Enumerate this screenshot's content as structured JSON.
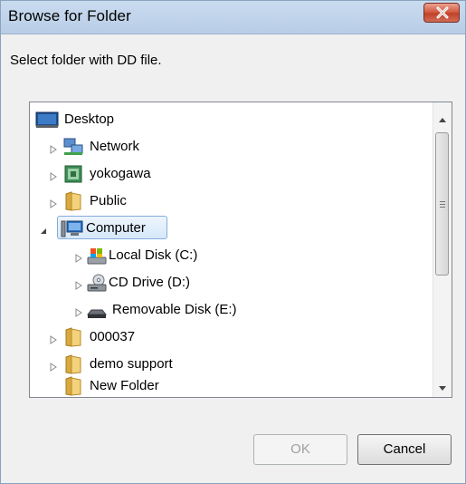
{
  "window": {
    "title": "Browse for Folder",
    "prompt": "Select folder with DD file."
  },
  "tree": {
    "items": [
      {
        "label": "Desktop",
        "icon": "desktop-icon",
        "expander": "none",
        "selected": false
      },
      {
        "label": "Network",
        "icon": "network-icon",
        "expander": "collapsed",
        "selected": false
      },
      {
        "label": "yokogawa",
        "icon": "user-folder-icon",
        "expander": "collapsed",
        "selected": false
      },
      {
        "label": "Public",
        "icon": "folder-icon",
        "expander": "collapsed",
        "selected": false
      },
      {
        "label": "Computer",
        "icon": "computer-icon",
        "expander": "expanded",
        "selected": true
      },
      {
        "label": "Local Disk (C:)",
        "icon": "local-disk-icon",
        "expander": "collapsed",
        "selected": false
      },
      {
        "label": "CD Drive (D:)",
        "icon": "cd-drive-icon",
        "expander": "collapsed",
        "selected": false
      },
      {
        "label": "Removable Disk (E:)",
        "icon": "removable-disk-icon",
        "expander": "collapsed",
        "selected": false
      },
      {
        "label": "000037",
        "icon": "folder-icon",
        "expander": "collapsed",
        "selected": false
      },
      {
        "label": "demo support",
        "icon": "folder-icon",
        "expander": "collapsed",
        "selected": false
      },
      {
        "label": "New Folder",
        "icon": "folder-icon",
        "expander": "none",
        "selected": false
      }
    ]
  },
  "buttons": {
    "ok": "OK",
    "cancel": "Cancel"
  },
  "colors": {
    "title_bar": "#c9dbef",
    "close_button": "#c2412a",
    "selection_border": "#84acdd",
    "dialog_background": "#f0f0f0"
  }
}
